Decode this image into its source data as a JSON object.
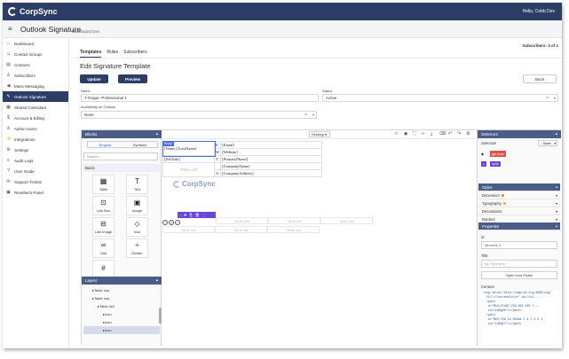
{
  "app": {
    "name": "CorpSync",
    "user": "Hello, Cobb Dev"
  },
  "header": {
    "title": "Outlook Signature",
    "breadcrumb": "Dashboard Dev"
  },
  "sidebar": {
    "items": [
      {
        "label": "Dashboard",
        "icon": "home-icon"
      },
      {
        "label": "Contact Groups",
        "icon": "users-icon"
      },
      {
        "label": "Contacts",
        "icon": "contact-icon"
      },
      {
        "label": "Subscribers",
        "icon": "user-icon"
      },
      {
        "label": "Mass Messaging",
        "icon": "megaphone-icon"
      },
      {
        "label": "Outlook Signature",
        "icon": "signature-icon",
        "active": true
      },
      {
        "label": "Shared Calendars",
        "icon": "calendar-icon"
      },
      {
        "label": "Account & Billing",
        "icon": "billing-icon"
      },
      {
        "label": "Admin Users",
        "icon": "admin-icon"
      },
      {
        "label": "Integrations",
        "icon": "integration-icon"
      },
      {
        "label": "Settings",
        "icon": "gear-icon"
      },
      {
        "label": "Audit Logs",
        "icon": "log-icon"
      },
      {
        "label": "User Guide",
        "icon": "guide-icon"
      },
      {
        "label": "Support Tickets",
        "icon": "ticket-icon"
      },
      {
        "label": "Reseltech Panel",
        "icon": "panel-icon"
      }
    ]
  },
  "main": {
    "subscribers": "Subscribers: 3 of 1",
    "tabs": [
      "Templates",
      "Rules",
      "Subscribers"
    ],
    "heading": "Edit Signature Template",
    "update_label": "Update",
    "preview_label": "Preview",
    "back_label": "Back",
    "name_label": "Name",
    "name_value": "T-Grape- Professional 1",
    "status_label": "Status",
    "status_value": "Active",
    "availability_label": "Availability on Outlook",
    "availability_value": "None"
  },
  "editor": {
    "blocks_title": "Blocks",
    "seg_regular": "Regular",
    "seg_symbols": "Symbols",
    "search_placeholder": "Search...",
    "basic_group": "Basic",
    "blocks": [
      {
        "label": "Table",
        "icon": "table-icon",
        "glyph": "▦"
      },
      {
        "label": "Text",
        "icon": "text-icon",
        "glyph": "T"
      },
      {
        "label": "Link Box",
        "icon": "link-box-icon",
        "glyph": "⊡"
      },
      {
        "label": "Image",
        "icon": "image-icon",
        "glyph": "▣"
      },
      {
        "label": "Link Image",
        "icon": "link-image-icon",
        "glyph": "⊟"
      },
      {
        "label": "Icon",
        "icon": "diamond-icon",
        "glyph": "◇"
      },
      {
        "label": "Link",
        "icon": "link-icon",
        "glyph": "∞"
      },
      {
        "label": "Divider",
        "icon": "divider-icon",
        "glyph": "÷"
      },
      {
        "label": "",
        "icon": "hash-icon",
        "glyph": "#"
      }
    ],
    "layers_title": "Layers",
    "layers": [
      "Table row",
      "Table row",
      "Table cell",
      "Icon",
      "Icon",
      "Icon"
    ],
    "device": "Desktop",
    "badge": "Body",
    "sig": {
      "name": "[Name] [LastName]",
      "title": "[JobTitle]",
      "email": "[Email]",
      "website": "[Website]",
      "phone": "[PrimaryPhone]",
      "company": "[CompanyName]",
      "address": "[CompanyAddress]",
      "table_cell": "Table cell",
      "c_e": "E",
      "c_w": "W",
      "c_t": "T",
      "c_a": "A"
    },
    "selector_title": "Selectors",
    "selection_label": "Selection",
    "state_value": "- State -",
    "selector_tag": "gjs-icon",
    "class_tag": "sync",
    "styles_title": "Styles",
    "styles_sections": [
      "Dimension",
      "Typography",
      "Decorations",
      "Borders"
    ],
    "properties_title": "Properties",
    "id_label": "Id",
    "id_value": "Iamneid-3",
    "title_label": "Title",
    "title_placeholder": "eg. Text here",
    "icon_picker": "Open Icon Picker",
    "content_label": "Content",
    "code_lines": [
      "<svg xmlns=\"http://www.w3.org/2000/svg\"",
      "  fill=\"currentColor\" id=\"iti-...",
      "  <path",
      "   d=\"M10.07467 239.834.025 7...",
      "   id=\"i69g5e\"></path>",
      "  <path",
      "   d=\"M26.759 12.094a4.7 4.7 0 0 1",
      "   id=\"i39q1l\"></path>"
    ]
  }
}
